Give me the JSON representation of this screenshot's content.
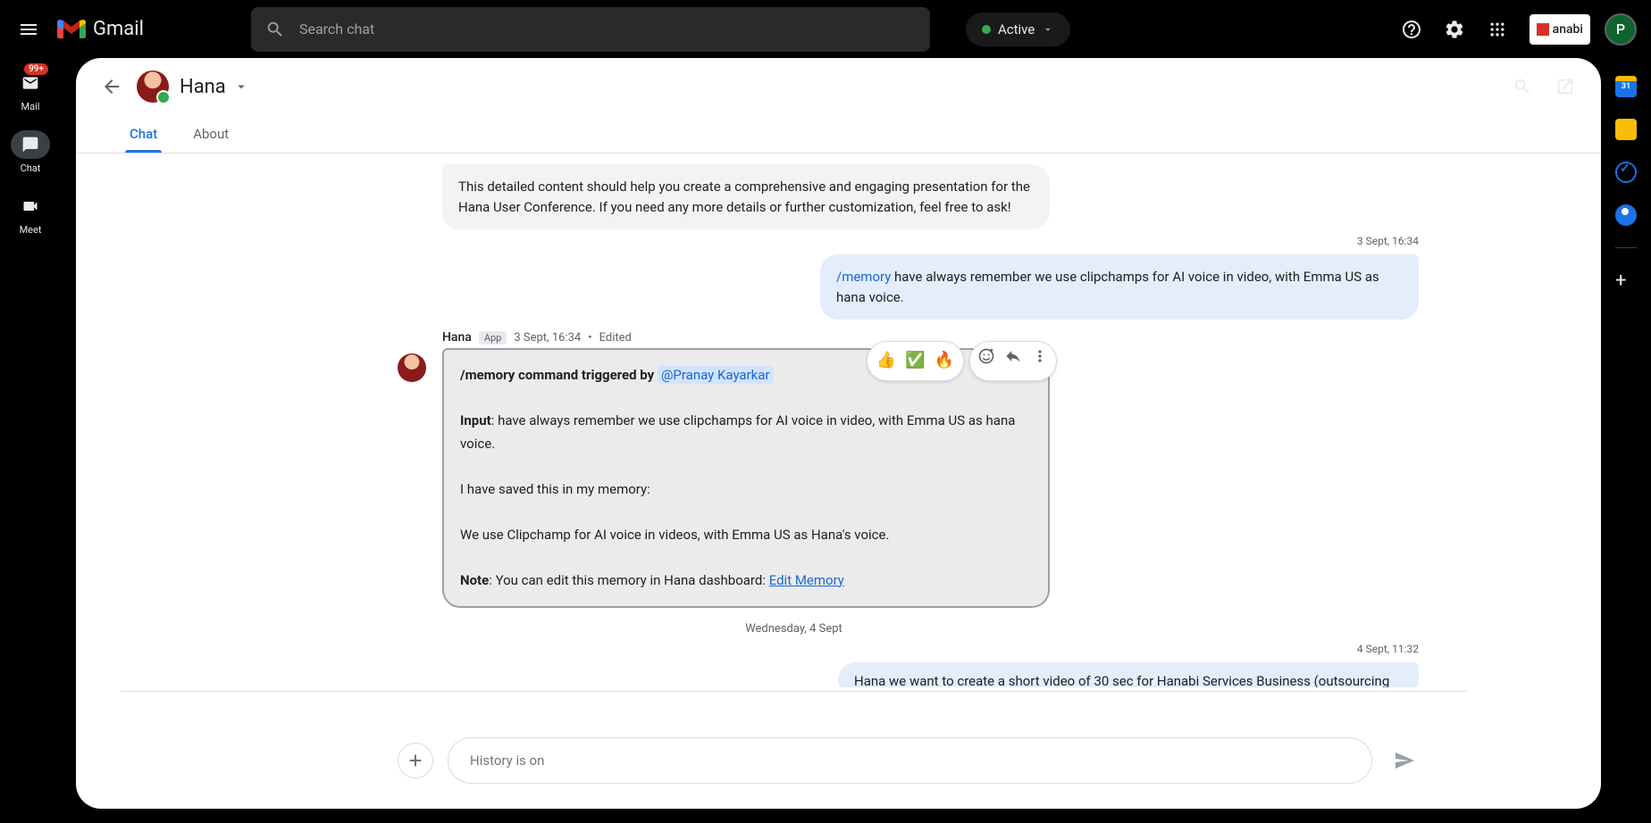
{
  "header": {
    "search_placeholder": "Search chat",
    "active_label": "Active",
    "org_text": "anabi",
    "avatar_initial": "P"
  },
  "rail": {
    "mail": "Mail",
    "badge": "99+",
    "chat": "Chat",
    "meet": "Meet"
  },
  "right_rail": {
    "cal_day": "31"
  },
  "chat": {
    "contact_name": "Hana",
    "tabs": {
      "chat": "Chat",
      "about": "About"
    }
  },
  "messages": {
    "grey1": "This detailed content should help you create a comprehensive and engaging presentation for the Hana User Conference. If you need any more details or further customization, feel free to ask!",
    "time1": "3 Sept, 16:34",
    "blue1_cmd": "/memory",
    "blue1_text": " have always remember we use clipchamps for AI voice in video, with Emma US as hana voice.",
    "meta": {
      "sender": "Hana",
      "app": "App",
      "time": "3 Sept, 16:34",
      "edited": "Edited"
    },
    "boxed": {
      "triggered_pre": "/memory command triggered by ",
      "mention": "@Pranay Kayarkar",
      "input_label": "Input",
      "input_text": ": have always remember we use clipchamps for AI voice in video, with Emma US as hana voice.",
      "saved": "I have saved this in my memory:",
      "summary": "We use Clipchamp for AI voice in videos, with Emma US as Hana's voice.",
      "note_label": "Note",
      "note_text": ": You can edit this memory in Hana dashboard: ",
      "edit_link": "Edit Memory"
    },
    "reactions": {
      "r1": "👍",
      "r2": "✅",
      "r3": "🔥"
    },
    "date_divider": "Wednesday, 4 Sept",
    "time2": "4 Sept, 11:32",
    "blue2": "Hana we want to create a short video of 30 sec for Hanabi Services Business (outsourcing"
  },
  "composer": {
    "placeholder": "History is on"
  }
}
